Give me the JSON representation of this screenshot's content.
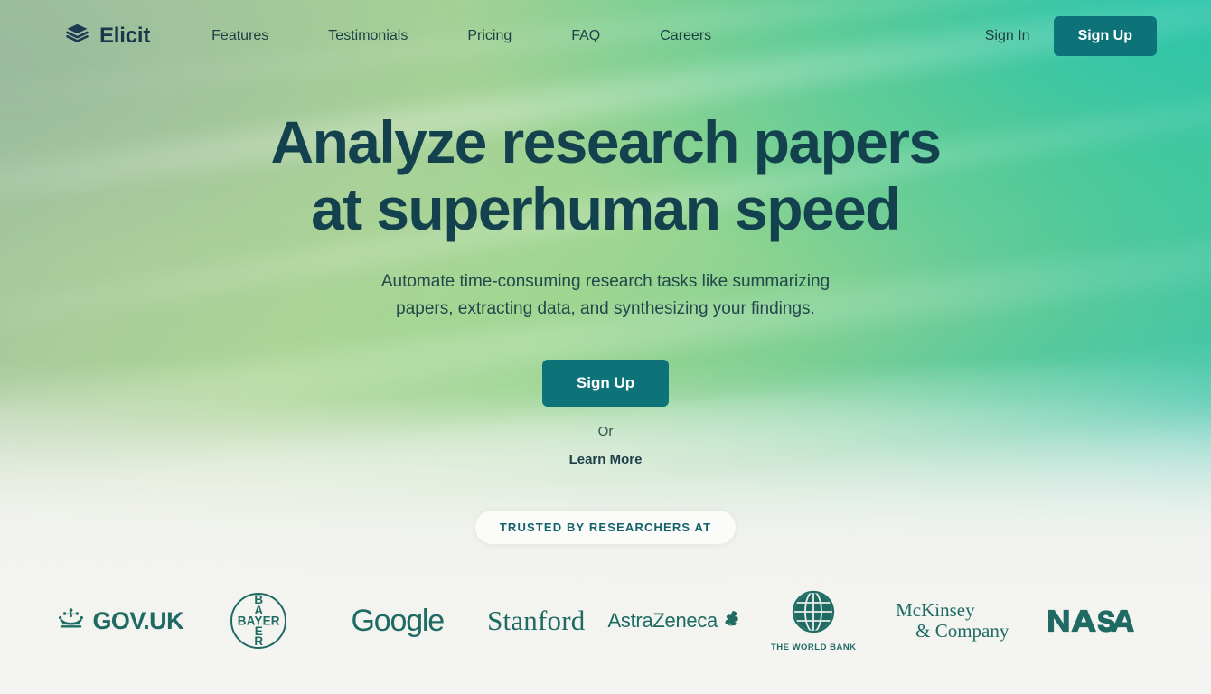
{
  "brand": {
    "name": "Elicit",
    "logo_icon": "stacked-books-icon"
  },
  "nav": {
    "links": [
      {
        "label": "Features"
      },
      {
        "label": "Testimonials"
      },
      {
        "label": "Pricing"
      },
      {
        "label": "FAQ"
      },
      {
        "label": "Careers"
      }
    ],
    "sign_in_label": "Sign In",
    "sign_up_label": "Sign Up"
  },
  "hero": {
    "title_line1": "Analyze research papers",
    "title_line2": "at superhuman speed",
    "subtitle_line1": "Automate time-consuming research tasks like summarizing",
    "subtitle_line2": "papers, extracting data, and synthesizing your findings.",
    "cta_label": "Sign Up",
    "or_label": "Or",
    "secondary_cta_label": "Learn More"
  },
  "trusted": {
    "badge_label": "TRUSTED BY RESEARCHERS AT",
    "logos": [
      {
        "name": "gov-uk",
        "text": "GOV.UK",
        "icon": "crown-icon"
      },
      {
        "name": "bayer",
        "text": "BAYER",
        "icon": "bayer-cross-circle-icon"
      },
      {
        "name": "google",
        "text": "Google"
      },
      {
        "name": "stanford",
        "text": "Stanford"
      },
      {
        "name": "astrazeneca",
        "text": "AstraZeneca",
        "icon": "astrazeneca-swirl-icon"
      },
      {
        "name": "world-bank",
        "text": "THE WORLD BANK",
        "icon": "globe-icon"
      },
      {
        "name": "mckinsey",
        "text_line1": "McKinsey",
        "text_line2": "& Company"
      },
      {
        "name": "nasa",
        "text": "NASA"
      }
    ]
  },
  "colors": {
    "accent_teal": "#0D7379",
    "heading": "#14414E",
    "logo_green": "#1F6B64",
    "badge_text": "#14626B",
    "page_bottom": "#F3F3F0"
  }
}
